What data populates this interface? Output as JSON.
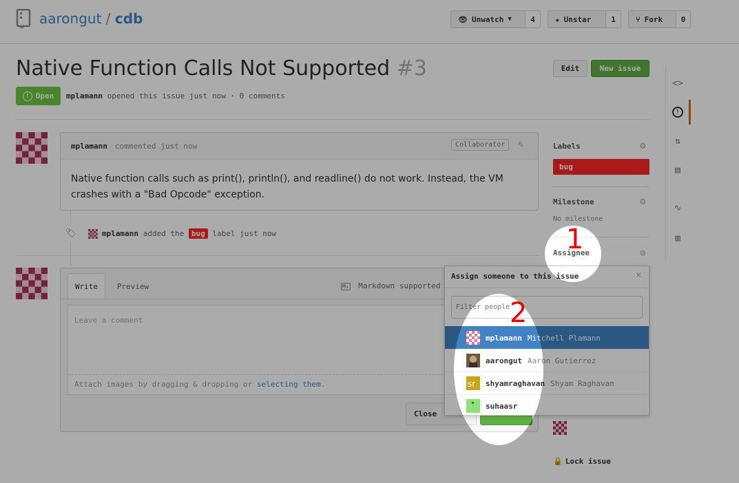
{
  "header": {
    "owner": "aarongut",
    "separator": "/",
    "repo": "cdb",
    "unwatch": {
      "label": "Unwatch",
      "count": "4"
    },
    "unstar": {
      "label": "Unstar",
      "count": "1"
    },
    "fork": {
      "label": "Fork",
      "count": "0"
    }
  },
  "issue": {
    "title": "Native Function Calls Not Supported",
    "number": "#3",
    "state": "Open",
    "author": "mplamann",
    "meta": "opened this issue just now · 0 comments",
    "edit_label": "Edit",
    "new_issue_label": "New issue"
  },
  "comment": {
    "author": "mplamann",
    "time": "commented just now",
    "badge": "Collaborator",
    "body": "Native function calls such as print(), println(), and readline() do not work. Instead, the VM crashes with a \"Bad Opcode\" exception."
  },
  "event": {
    "actor": "mplamann",
    "prefix": "added the",
    "label": "bug",
    "suffix": "label just now"
  },
  "composer": {
    "tab_write": "Write",
    "tab_preview": "Preview",
    "markdown": "Markdown supported",
    "placeholder": "Leave a comment",
    "attach_prefix": "Attach images by dragging & dropping or ",
    "attach_link": "selecting them",
    "attach_suffix": ".",
    "close_label": "Close"
  },
  "sidebar": {
    "labels_heading": "Labels",
    "label_bug": "bug",
    "milestone_heading": "Milestone",
    "milestone_value": "No milestone",
    "assignee_heading": "Assignee",
    "lock_label": "Lock issue"
  },
  "assign_popup": {
    "title": "Assign someone to this issue",
    "filter_placeholder": "Filter people",
    "people": [
      {
        "login": "mplamann",
        "name": "Mitchell Plamann",
        "selected": true
      },
      {
        "login": "aarongut",
        "name": "Aaron Gutierrez",
        "selected": false
      },
      {
        "login": "shyamraghavan",
        "name": "Shyam Raghavan",
        "selected": false
      },
      {
        "login": "suhaasr",
        "name": "",
        "selected": false
      }
    ]
  },
  "annotations": {
    "marker1": "1",
    "marker2": "2"
  },
  "colors": {
    "accent": "#4183c4",
    "open_green": "#6cc644",
    "bug_red": "#fc2929",
    "marker_red": "#e00000"
  }
}
